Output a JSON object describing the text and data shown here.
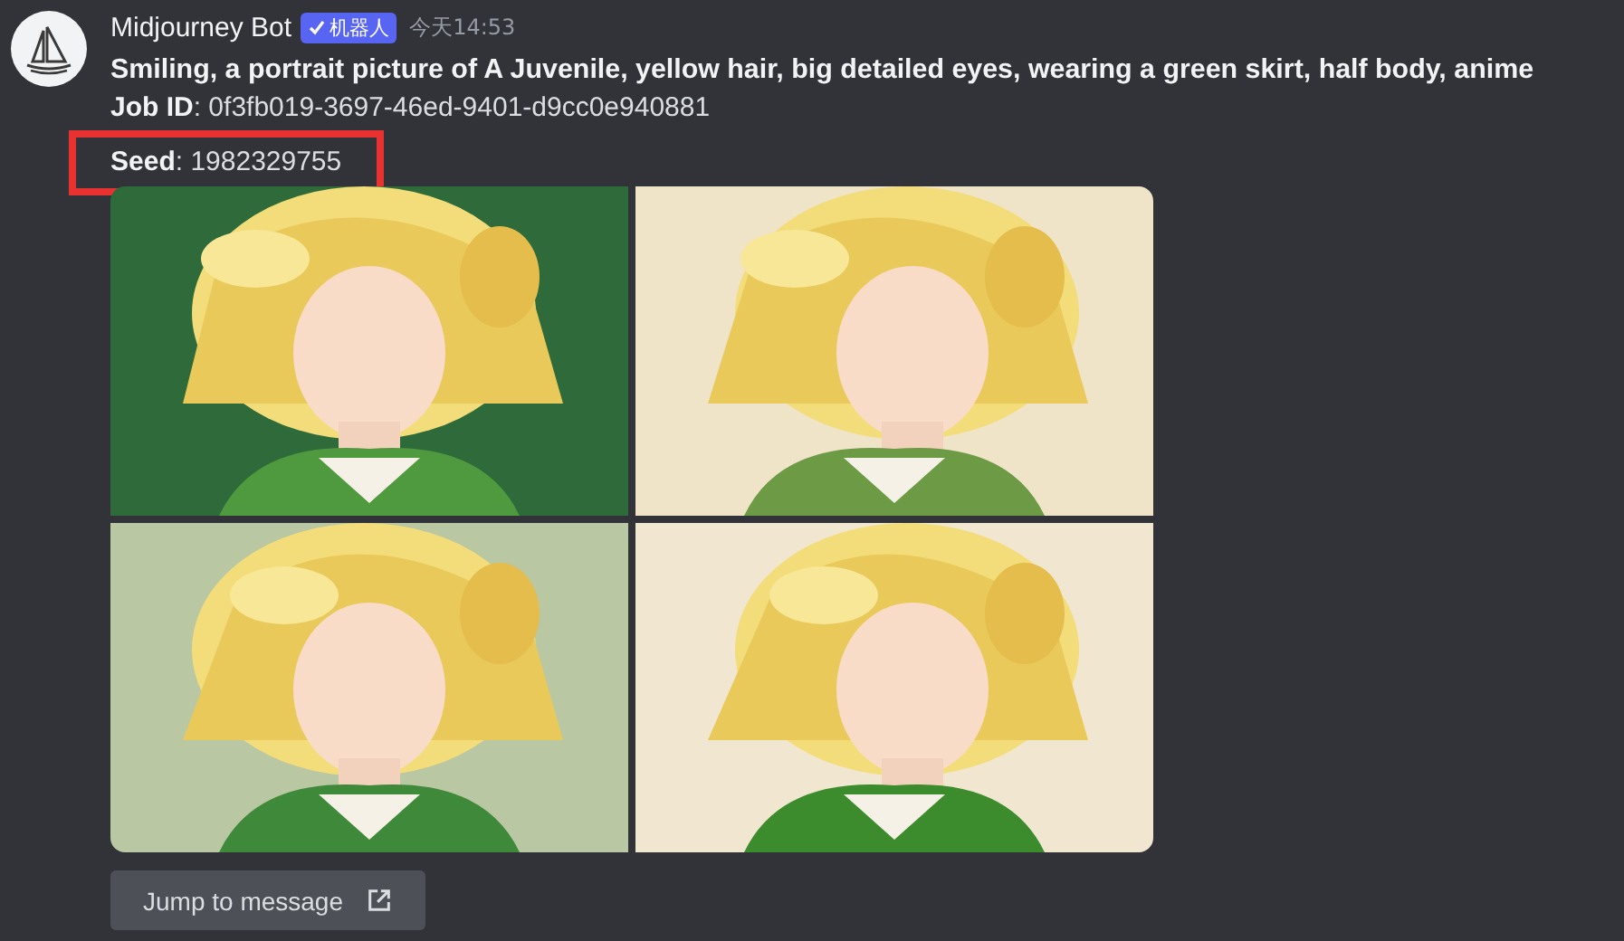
{
  "author": {
    "name": "Midjourney Bot",
    "badge": "机器人",
    "timestamp": "今天14:53"
  },
  "prompt": "Smiling, a portrait picture of A Juvenile, yellow hair, big detailed eyes, wearing a green skirt, half body, anime",
  "fields": [
    {
      "text": "**Job ID**: 0f3fb019-3697-46ed-9401-d9cc0e940881",
      "highlighted": false
    },
    {
      "text": "**Seed**: 1982329755",
      "highlighted": true
    }
  ],
  "button": {
    "label": "Jump to message"
  }
}
